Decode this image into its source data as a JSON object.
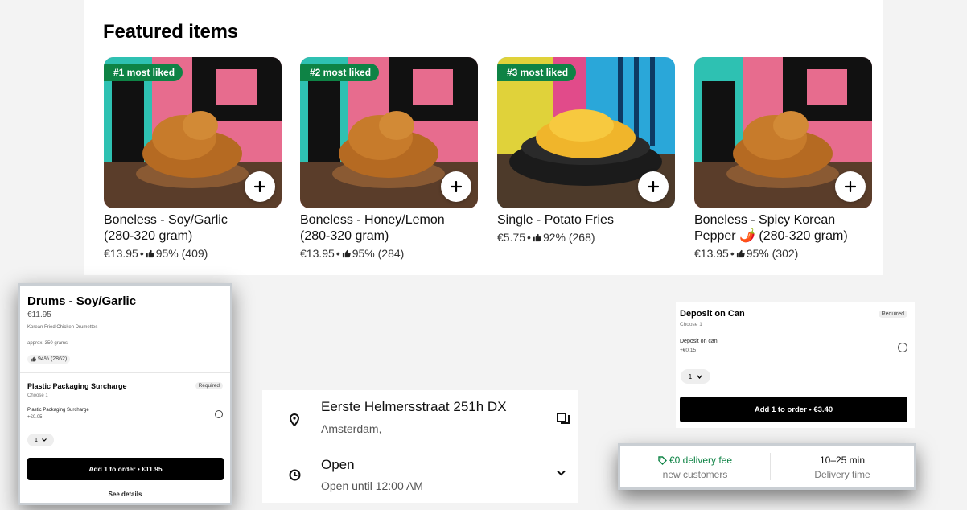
{
  "featured": {
    "title": "Featured items",
    "items": [
      {
        "badge": "#1 most liked",
        "name_line1": "Boneless  - Soy/Garlic",
        "name_line2": "(280-320 gram)",
        "price": "€13.95",
        "rating": "95% (409)",
        "image": "chicken"
      },
      {
        "badge": "#2 most liked",
        "name_line1": "Boneless - Honey/Lemon",
        "name_line2": "(280-320 gram)",
        "price": "€13.95",
        "rating": "95% (284)",
        "image": "chicken"
      },
      {
        "badge": "#3 most liked",
        "name_line1": "Single - Potato Fries",
        "name_line2": "",
        "price": "€5.75",
        "rating": "92% (268)",
        "image": "fries"
      },
      {
        "badge": "",
        "name_line1": "Boneless - Spicy Korean",
        "name_line2": "Pepper 🌶️  (280-320 gram)",
        "price": "€13.95",
        "rating": "95% (302)",
        "image": "chicken"
      }
    ]
  },
  "item_popup": {
    "title": "Drums - Soy/Garlic",
    "price": "€11.95",
    "description": "Korean Fried Chicken Drumettes -",
    "approx": "approx. 350 grams",
    "likes": "94% (2862)",
    "section_title": "Plastic Packaging Surcharge",
    "required": "Required",
    "choose": "Choose 1",
    "option_label": "Plastic Packaging Surcharge",
    "option_price": "+€0.05",
    "qty": "1",
    "add_button": "Add 1 to order • €11.95",
    "see_details": "See details"
  },
  "address": {
    "street": "Eerste Helmersstraat 251h DX",
    "city": "Amsterdam,",
    "status": "Open",
    "hours": "Open until 12:00 AM"
  },
  "deposit_popup": {
    "title": "Deposit on Can",
    "choose": "Choose 1",
    "required": "Required",
    "option_label": "Deposit on can",
    "option_price": "+€0.15",
    "qty": "1",
    "add_button": "Add 1 to order • €3.40"
  },
  "delivery": {
    "fee": "€0 delivery fee",
    "fee_sub": "new customers",
    "time": "10–25 min",
    "time_sub": "Delivery time"
  },
  "colors": {
    "accent_green": "#0e8345",
    "button_black": "#000000"
  }
}
